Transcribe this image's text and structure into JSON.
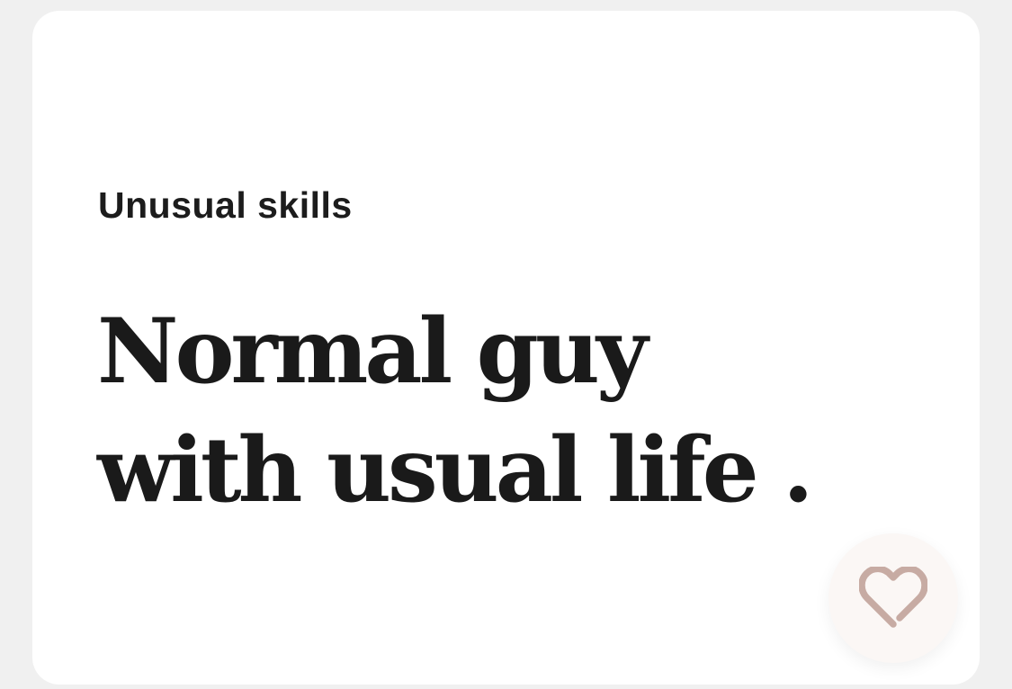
{
  "card": {
    "prompt_label": "Unusual skills",
    "answer": "Normal guy with usual life ."
  },
  "like_button": {
    "icon": "heart-icon",
    "icon_color": "#c7aba3",
    "background": "#fbf7f5"
  },
  "colors": {
    "page_background": "#f0f0f0",
    "card_background": "#ffffff",
    "text": "#1a1a1a"
  }
}
